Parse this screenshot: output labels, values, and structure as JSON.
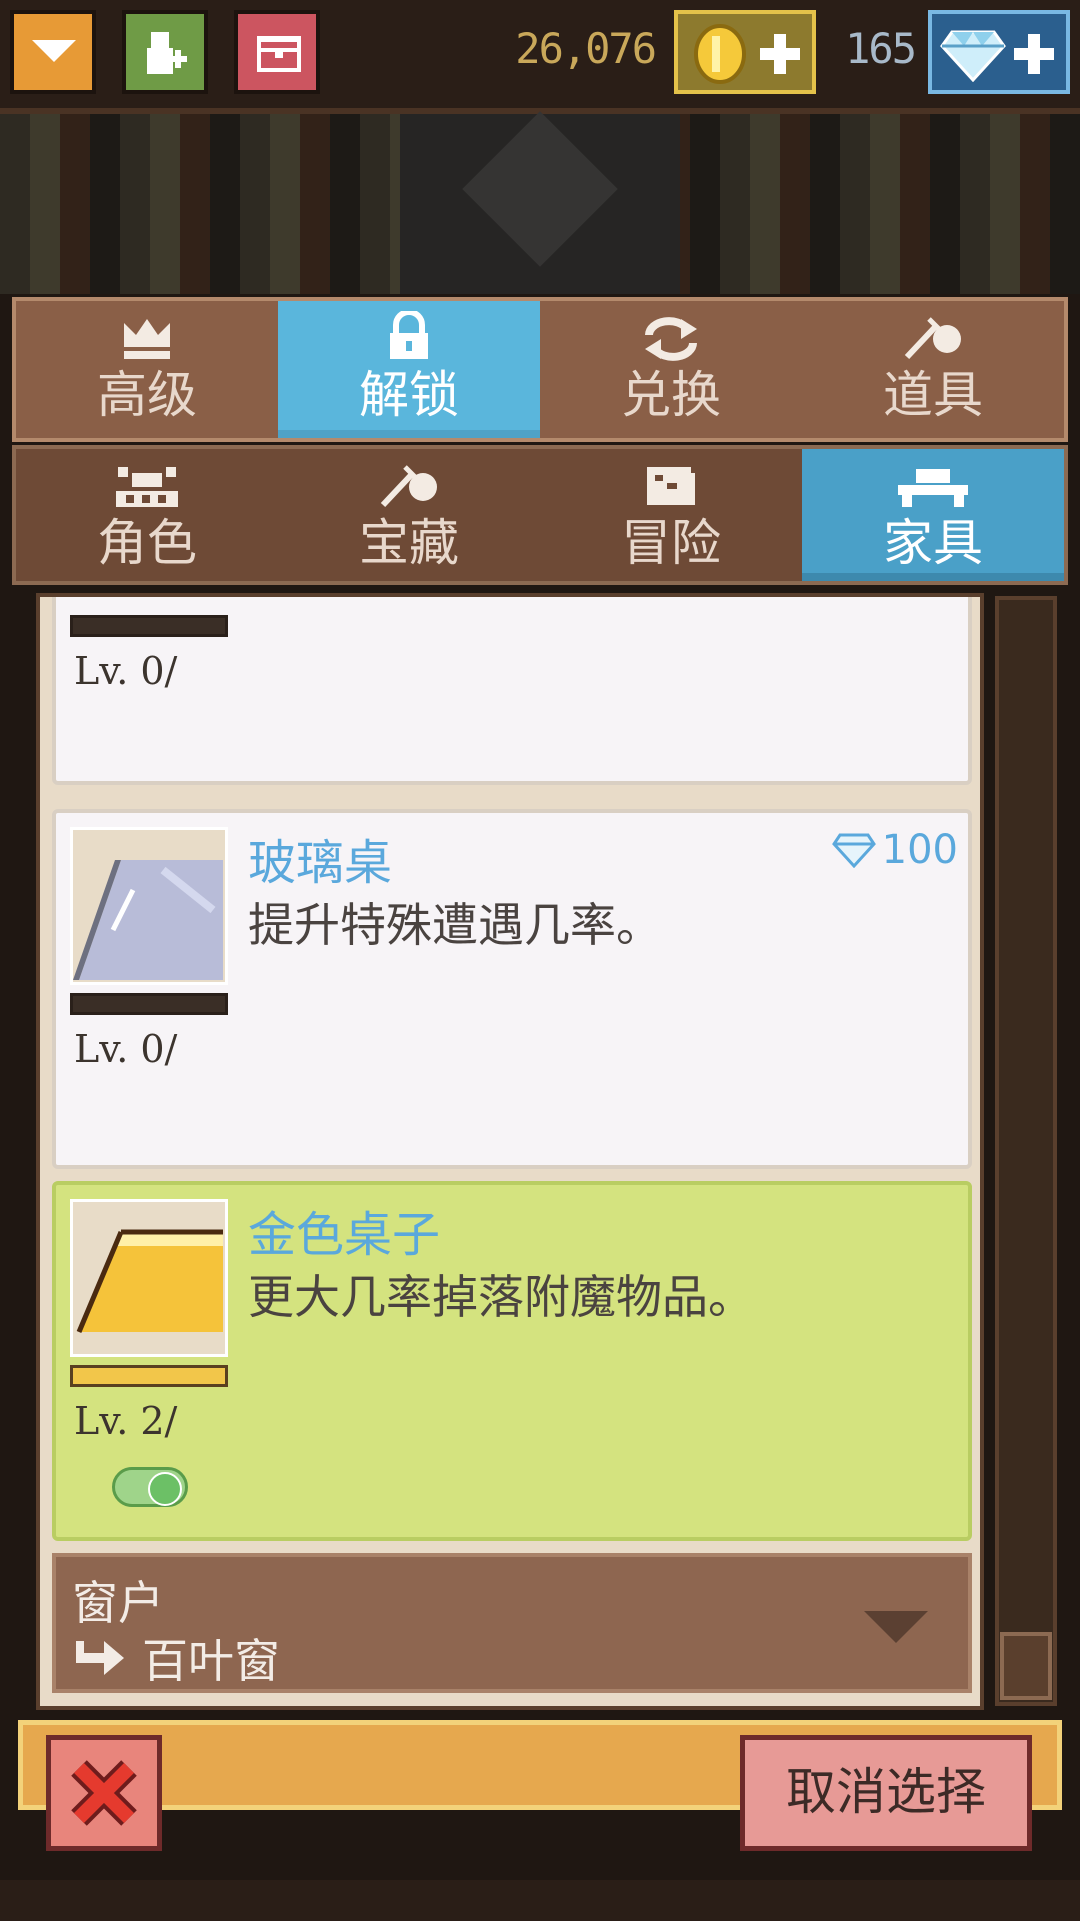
{
  "topbar": {
    "coins": "26,076",
    "gems": "165"
  },
  "tabs_row1": [
    {
      "label": "高级",
      "icon": "crown-icon"
    },
    {
      "label": "解锁",
      "icon": "lock-icon",
      "active": true
    },
    {
      "label": "兑换",
      "icon": "exchange-icon"
    },
    {
      "label": "道具",
      "icon": "item-icon"
    }
  ],
  "tabs_row2": [
    {
      "label": "角色",
      "icon": "character-icon"
    },
    {
      "label": "宝藏",
      "icon": "treasure-icon"
    },
    {
      "label": "冒险",
      "icon": "scroll-icon"
    },
    {
      "label": "家具",
      "icon": "furniture-icon",
      "active": true
    }
  ],
  "items": [
    {
      "level": "Lv.  0/"
    },
    {
      "name": "玻璃桌",
      "description": "提升特殊遭遇几率。",
      "price": "100",
      "level": "Lv.  0/"
    },
    {
      "name": "金色桌子",
      "description": "更大几率掉落附魔物品。",
      "level": "Lv.  2/",
      "toggle": "on"
    }
  ],
  "category": {
    "title": "窗户",
    "value": "百叶窗"
  },
  "buttons": {
    "deselect": "取消选择"
  },
  "colors": {
    "active_tab": "#5ab6dc",
    "selected_card": "#d4e37f",
    "accent_blue": "#5aa8dc",
    "bottom_bar": "#e6a84e"
  }
}
